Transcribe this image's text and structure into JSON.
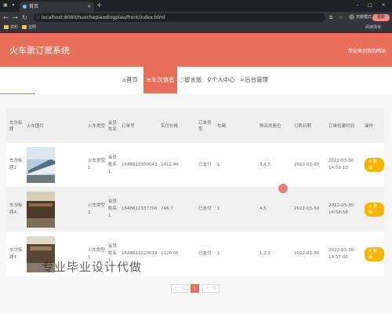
{
  "browser": {
    "tab_title": "首页",
    "url": "localhost:8080/huochepiaodingpiao/front/index.html",
    "mode": "无痕模式",
    "update_label": "更新",
    "bookmarks": [
      "资料",
      "证照"
    ],
    "reading_list": "阅读清单"
  },
  "header": {
    "title": "火车票订票系统",
    "welcome": "欢迎来到我的网站"
  },
  "nav": {
    "items": [
      {
        "label": "首页",
        "icon": "home-icon",
        "glyph": "⌂"
      },
      {
        "label": "车次信息",
        "icon": "train-icon",
        "glyph": "≡"
      },
      {
        "label": "留言版",
        "icon": "message-icon",
        "glyph": "◌"
      },
      {
        "label": "个人中心",
        "icon": "user-icon",
        "glyph": "♀"
      },
      {
        "label": "后台管理",
        "icon": "link-icon",
        "glyph": "∞"
      }
    ],
    "active_index": 1
  },
  "table": {
    "columns": [
      "车次标题",
      "火车图片",
      "火车类型",
      "会员姓名",
      "订单号",
      "实付价格",
      "订单类型",
      "车厢",
      "购买的座位",
      "订购日期",
      "订单创建时间",
      "操作"
    ],
    "rows": [
      {
        "title": "车次标题2",
        "image": "train-photo-1",
        "type": "火车类型1",
        "member": "会员姓名1",
        "order_no": "1648622350043",
        "price": "1412.46",
        "order_type": "已支付",
        "carriage": "1",
        "seats": "3,4,5",
        "date": "2022-03-30",
        "created_date": "2022-03-30",
        "created_time": "14:59:10",
        "action": "删除"
      },
      {
        "title": "车次标题4",
        "image": "train-photo-2",
        "type": "火车类型2",
        "member": "会员姓名1",
        "order_no": "1648622337704",
        "price": "746.7",
        "order_type": "已支付",
        "carriage": "1",
        "seats": "4,5",
        "date": "2022-03-30",
        "created_date": "2022-03-30",
        "created_time": "14:58:58",
        "action": "删除"
      },
      {
        "title": "车次标题4",
        "image": "train-photo-3",
        "type": "火车类型1",
        "member": "会员姓名1",
        "order_no": "1648622220019",
        "price": "1120.05",
        "order_type": "已支付",
        "carriage": "1",
        "seats": "1,2,3",
        "date": "2022-03-30",
        "created_date": "2022-03-30",
        "created_time": "14:57:00",
        "action": "删除"
      }
    ]
  },
  "pagination": {
    "prev": "上一页",
    "current": "1",
    "next": "下一页"
  },
  "watermark": "专业毕业设计代做",
  "colors": {
    "brand": "#e8705a",
    "action": "#f7b500"
  }
}
